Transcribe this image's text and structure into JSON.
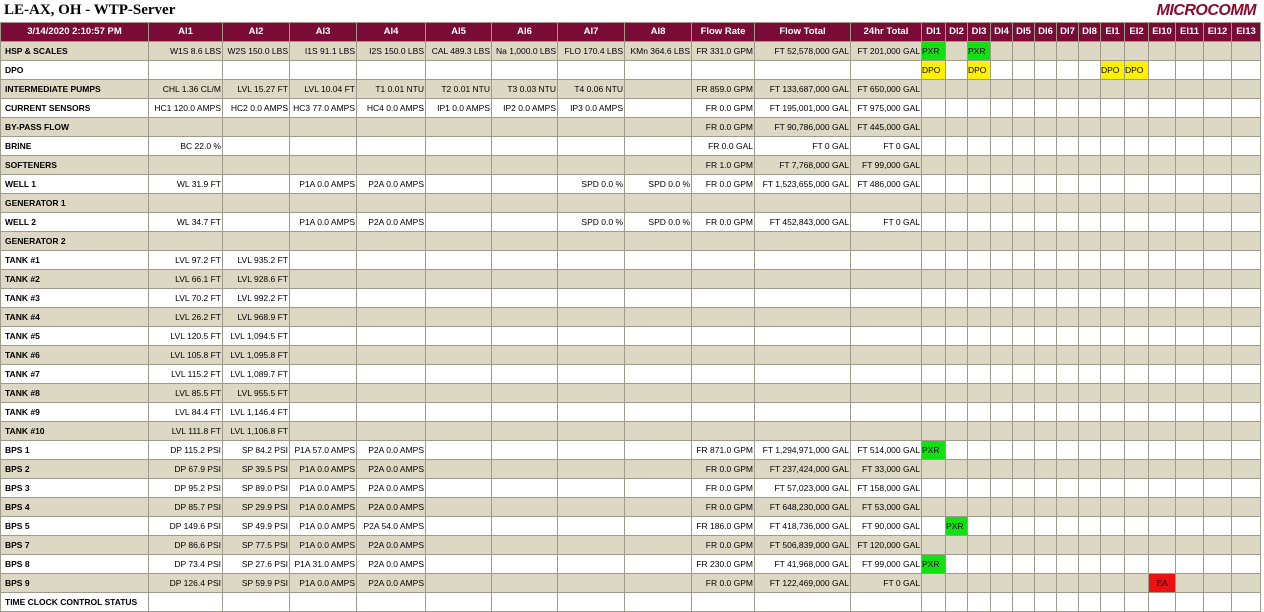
{
  "header": {
    "title": "LE-AX, OH - WTP-Server",
    "logo": "MICROCOMM"
  },
  "table": {
    "columns": [
      "3/14/2020 2:10:57 PM",
      "AI1",
      "AI2",
      "AI3",
      "AI4",
      "AI5",
      "AI6",
      "AI7",
      "AI8",
      "Flow Rate",
      "Flow Total",
      "24hr Total",
      "DI1",
      "DI2",
      "DI3",
      "DI4",
      "DI5",
      "DI6",
      "DI7",
      "DI8",
      "EI1",
      "EI2",
      "EI10",
      "EI11",
      "EI12",
      "EI13"
    ],
    "rows": [
      {
        "label": "HSP & SCALES",
        "cells": [
          "W1S 8.6 LBS",
          "W2S 150.0 LBS",
          "I1S 91.1 LBS",
          "I2S 150.0 LBS",
          "CAL 489.3 LBS",
          "Na 1,000.0 LBS",
          "FLO 170.4 LBS",
          "KMn 364.6 LBS",
          "FR 331.0 GPM",
          "FT 52,578,000 GAL",
          "FT 201,000 GAL",
          "PXR",
          "",
          "PXR",
          "",
          "",
          "",
          "",
          "",
          "",
          "",
          "",
          "",
          "",
          ""
        ]
      },
      {
        "label": "DPO",
        "cells": [
          "",
          "",
          "",
          "",
          "",
          "",
          "",
          "",
          "",
          "",
          "",
          "DPO",
          "",
          "DPO",
          "",
          "",
          "",
          "",
          "",
          "DPO",
          "DPO",
          "",
          "",
          "",
          ""
        ]
      },
      {
        "label": "INTERMEDIATE PUMPS",
        "cells": [
          "CHL 1.36 CL/M",
          "LVL 15.27 FT",
          "LVL 10.04 FT",
          "T1 0.01 NTU",
          "T2 0.01 NTU",
          "T3 0.03 NTU",
          "T4 0.06 NTU",
          "",
          "FR 859.0 GPM",
          "FT 133,687,000 GAL",
          "FT 650,000 GAL",
          "",
          "",
          "",
          "",
          "",
          "",
          "",
          "",
          "",
          "",
          "",
          "",
          "",
          ""
        ]
      },
      {
        "label": "CURRENT SENSORS",
        "cells": [
          "HC1 120.0 AMPS",
          "HC2 0.0 AMPS",
          "HC3 77.0 AMPS",
          "HC4 0.0 AMPS",
          "IP1 0.0 AMPS",
          "IP2 0.0 AMPS",
          "IP3 0.0 AMPS",
          "",
          "FR 0.0 GPM",
          "FT 195,001,000 GAL",
          "FT 975,000 GAL",
          "",
          "",
          "",
          "",
          "",
          "",
          "",
          "",
          "",
          "",
          "",
          "",
          "",
          ""
        ]
      },
      {
        "label": "BY-PASS FLOW",
        "cells": [
          "",
          "",
          "",
          "",
          "",
          "",
          "",
          "",
          "FR 0.0 GPM",
          "FT 90,786,000 GAL",
          "FT 445,000 GAL",
          "",
          "",
          "",
          "",
          "",
          "",
          "",
          "",
          "",
          "",
          "",
          "",
          "",
          ""
        ]
      },
      {
        "label": "BRINE",
        "cells": [
          "BC 22.0 %",
          "",
          "",
          "",
          "",
          "",
          "",
          "",
          "FR 0.0 GAL",
          "FT 0 GAL",
          "FT 0 GAL",
          "",
          "",
          "",
          "",
          "",
          "",
          "",
          "",
          "",
          "",
          "",
          "",
          "",
          ""
        ]
      },
      {
        "label": "SOFTENERS",
        "cells": [
          "",
          "",
          "",
          "",
          "",
          "",
          "",
          "",
          "FR 1.0 GPM",
          "FT 7,768,000 GAL",
          "FT 99,000 GAL",
          "",
          "",
          "",
          "",
          "",
          "",
          "",
          "",
          "",
          "",
          "",
          "",
          "",
          ""
        ]
      },
      {
        "label": "WELL 1",
        "cells": [
          "WL 31.9 FT",
          "",
          "P1A 0.0 AMPS",
          "P2A 0.0 AMPS",
          "",
          "",
          "SPD 0.0 %",
          "SPD 0.0 %",
          "FR 0.0 GPM",
          "FT 1,523,655,000 GAL",
          "FT 486,000 GAL",
          "",
          "",
          "",
          "",
          "",
          "",
          "",
          "",
          "",
          "",
          "",
          "",
          "",
          ""
        ]
      },
      {
        "label": "GENERATOR 1",
        "cells": [
          "",
          "",
          "",
          "",
          "",
          "",
          "",
          "",
          "",
          "",
          "",
          "",
          "",
          "",
          "",
          "",
          "",
          "",
          "",
          "",
          "",
          "",
          "",
          "",
          ""
        ]
      },
      {
        "label": "WELL 2",
        "cells": [
          "WL 34.7 FT",
          "",
          "P1A 0.0 AMPS",
          "P2A 0.0 AMPS",
          "",
          "",
          "SPD 0.0 %",
          "SPD 0.0 %",
          "FR 0.0 GPM",
          "FT 452,843,000 GAL",
          "FT 0 GAL",
          "",
          "",
          "",
          "",
          "",
          "",
          "",
          "",
          "",
          "",
          "",
          "",
          "",
          ""
        ]
      },
      {
        "label": "GENERATOR 2",
        "cells": [
          "",
          "",
          "",
          "",
          "",
          "",
          "",
          "",
          "",
          "",
          "",
          "",
          "",
          "",
          "",
          "",
          "",
          "",
          "",
          "",
          "",
          "",
          "",
          "",
          ""
        ]
      },
      {
        "label": "TANK #1",
        "cells": [
          "LVL 97.2 FT",
          "LVL 935.2 FT",
          "",
          "",
          "",
          "",
          "",
          "",
          "",
          "",
          "",
          "",
          "",
          "",
          "",
          "",
          "",
          "",
          "",
          "",
          "",
          "",
          "",
          "",
          ""
        ]
      },
      {
        "label": "TANK #2",
        "cells": [
          "LVL 66.1 FT",
          "LVL 928.6 FT",
          "",
          "",
          "",
          "",
          "",
          "",
          "",
          "",
          "",
          "",
          "",
          "",
          "",
          "",
          "",
          "",
          "",
          "",
          "",
          "",
          "",
          "",
          ""
        ]
      },
      {
        "label": "TANK #3",
        "cells": [
          "LVL 70.2 FT",
          "LVL 992.2 FT",
          "",
          "",
          "",
          "",
          "",
          "",
          "",
          "",
          "",
          "",
          "",
          "",
          "",
          "",
          "",
          "",
          "",
          "",
          "",
          "",
          "",
          "",
          ""
        ]
      },
      {
        "label": "TANK #4",
        "cells": [
          "LVL 26.2 FT",
          "LVL 968.9 FT",
          "",
          "",
          "",
          "",
          "",
          "",
          "",
          "",
          "",
          "",
          "",
          "",
          "",
          "",
          "",
          "",
          "",
          "",
          "",
          "",
          "",
          "",
          ""
        ]
      },
      {
        "label": "TANK #5",
        "cells": [
          "LVL 120.5 FT",
          "LVL 1,094.5 FT",
          "",
          "",
          "",
          "",
          "",
          "",
          "",
          "",
          "",
          "",
          "",
          "",
          "",
          "",
          "",
          "",
          "",
          "",
          "",
          "",
          "",
          "",
          ""
        ]
      },
      {
        "label": "TANK #6",
        "cells": [
          "LVL 105.8 FT",
          "LVL 1,095.8 FT",
          "",
          "",
          "",
          "",
          "",
          "",
          "",
          "",
          "",
          "",
          "",
          "",
          "",
          "",
          "",
          "",
          "",
          "",
          "",
          "",
          "",
          "",
          ""
        ]
      },
      {
        "label": "TANK #7",
        "cells": [
          "LVL 115.2 FT",
          "LVL 1,089.7 FT",
          "",
          "",
          "",
          "",
          "",
          "",
          "",
          "",
          "",
          "",
          "",
          "",
          "",
          "",
          "",
          "",
          "",
          "",
          "",
          "",
          "",
          "",
          ""
        ]
      },
      {
        "label": "TANK #8",
        "cells": [
          "LVL 85.5 FT",
          "LVL 955.5 FT",
          "",
          "",
          "",
          "",
          "",
          "",
          "",
          "",
          "",
          "",
          "",
          "",
          "",
          "",
          "",
          "",
          "",
          "",
          "",
          "",
          "",
          "",
          ""
        ]
      },
      {
        "label": "TANK #9",
        "cells": [
          "LVL 84.4 FT",
          "LVL 1,146.4 FT",
          "",
          "",
          "",
          "",
          "",
          "",
          "",
          "",
          "",
          "",
          "",
          "",
          "",
          "",
          "",
          "",
          "",
          "",
          "",
          "",
          "",
          "",
          ""
        ]
      },
      {
        "label": "TANK #10",
        "cells": [
          "LVL 111.8 FT",
          "LVL 1,106.8 FT",
          "",
          "",
          "",
          "",
          "",
          "",
          "",
          "",
          "",
          "",
          "",
          "",
          "",
          "",
          "",
          "",
          "",
          "",
          "",
          "",
          "",
          "",
          ""
        ]
      },
      {
        "label": "BPS 1",
        "cells": [
          "DP 115.2 PSI",
          "SP 84.2 PSI",
          "P1A 57.0 AMPS",
          "P2A 0.0 AMPS",
          "",
          "",
          "",
          "",
          "FR 871.0 GPM",
          "FT 1,294,971,000 GAL",
          "FT 514,000 GAL",
          "PXR",
          "",
          "",
          "",
          "",
          "",
          "",
          "",
          "",
          "",
          "",
          "",
          "",
          ""
        ]
      },
      {
        "label": "BPS 2",
        "cells": [
          "DP 67.9 PSI",
          "SP 39.5 PSI",
          "P1A 0.0 AMPS",
          "P2A 0.0 AMPS",
          "",
          "",
          "",
          "",
          "FR 0.0 GPM",
          "FT 237,424,000 GAL",
          "FT 33,000 GAL",
          "",
          "",
          "",
          "",
          "",
          "",
          "",
          "",
          "",
          "",
          "",
          "",
          "",
          ""
        ]
      },
      {
        "label": "BPS 3",
        "cells": [
          "DP 95.2 PSI",
          "SP 89.0 PSI",
          "P1A 0.0 AMPS",
          "P2A 0.0 AMPS",
          "",
          "",
          "",
          "",
          "FR 0.0 GPM",
          "FT 57,023,000 GAL",
          "FT 158,000 GAL",
          "",
          "",
          "",
          "",
          "",
          "",
          "",
          "",
          "",
          "",
          "",
          "",
          "",
          ""
        ]
      },
      {
        "label": "BPS 4",
        "cells": [
          "DP 85.7 PSI",
          "SP 29.9 PSI",
          "P1A 0.0 AMPS",
          "P2A 0.0 AMPS",
          "",
          "",
          "",
          "",
          "FR 0.0 GPM",
          "FT 648,230,000 GAL",
          "FT 53,000 GAL",
          "",
          "",
          "",
          "",
          "",
          "",
          "",
          "",
          "",
          "",
          "",
          "",
          "",
          ""
        ]
      },
      {
        "label": "BPS 5",
        "cells": [
          "DP 149.6 PSI",
          "SP 49.9 PSI",
          "P1A 0.0 AMPS",
          "P2A 54.0 AMPS",
          "",
          "",
          "",
          "",
          "FR 186.0 GPM",
          "FT 418,736,000 GAL",
          "FT 90,000 GAL",
          "",
          "PXR",
          "",
          "",
          "",
          "",
          "",
          "",
          "",
          "",
          "",
          "",
          "",
          ""
        ]
      },
      {
        "label": "BPS 7",
        "cells": [
          "DP 86.6 PSI",
          "SP 77.5 PSI",
          "P1A 0.0 AMPS",
          "P2A 0.0 AMPS",
          "",
          "",
          "",
          "",
          "FR 0.0 GPM",
          "FT 506,839,000 GAL",
          "FT 120,000 GAL",
          "",
          "",
          "",
          "",
          "",
          "",
          "",
          "",
          "",
          "",
          "",
          "",
          "",
          ""
        ]
      },
      {
        "label": "BPS 8",
        "cells": [
          "DP 73.4 PSI",
          "SP 27.6 PSI",
          "P1A 31.0 AMPS",
          "P2A 0.0 AMPS",
          "",
          "",
          "",
          "",
          "FR 230.0 GPM",
          "FT 41,968,000 GAL",
          "FT 99,000 GAL",
          "PXR",
          "",
          "",
          "",
          "",
          "",
          "",
          "",
          "",
          "",
          "",
          "",
          "",
          ""
        ]
      },
      {
        "label": "BPS 9",
        "cells": [
          "DP 126.4 PSI",
          "SP 59.9 PSI",
          "P1A 0.0 AMPS",
          "P2A 0.0 AMPS",
          "",
          "",
          "",
          "",
          "FR 0.0 GPM",
          "FT 122,469,000 GAL",
          "FT 0 GAL",
          "",
          "",
          "",
          "",
          "",
          "",
          "",
          "",
          "",
          "",
          "EA",
          "",
          "",
          ""
        ]
      },
      {
        "label": "TIME CLOCK CONTROL STATUS",
        "cells": [
          "",
          "",
          "",
          "",
          "",
          "",
          "",
          "",
          "",
          "",
          "",
          "",
          "",
          "",
          "",
          "",
          "",
          "",
          "",
          "",
          "",
          "",
          "",
          "",
          ""
        ]
      }
    ]
  },
  "colors": {
    "header_bg": "#7a0a36",
    "row_alt": "#ddd8c4",
    "pxr": "#11e011",
    "dpo": "#fff200",
    "ea": "#ee1111"
  }
}
